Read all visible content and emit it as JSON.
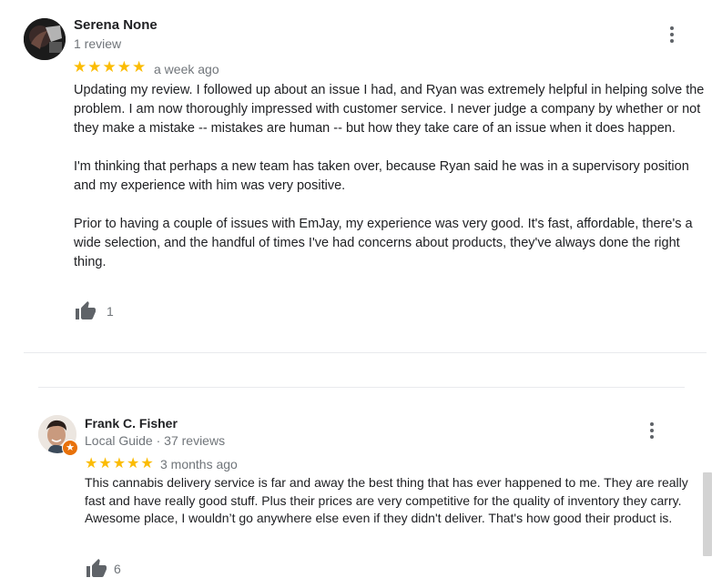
{
  "reviews": [
    {
      "author": "Serena None",
      "meta": "1 review",
      "stars": "★★★★★",
      "rating": 5,
      "time": "a week ago",
      "paragraphs": [
        "Updating my review. I followed up about an issue I had, and Ryan was extremely helpful in helping solve the problem. I am now thoroughly impressed with customer service. I never judge a company by whether or not they make a mistake -- mistakes are human -- but how they take care of an issue when it does happen.",
        "I'm thinking that perhaps a new team has taken over, because Ryan said he was in a supervisory position and my experience with him was very positive.",
        "Prior to having a couple of issues with EmJay, my experience was very good. It's fast, affordable, there's a wide selection, and the handful of times I've had concerns about products, they've always done the right thing."
      ],
      "likes": "1"
    },
    {
      "author": "Frank C. Fisher",
      "meta": "Local Guide · 37 reviews",
      "stars": "★★★★★",
      "rating": 5,
      "time": "3 months ago",
      "paragraphs": [
        "This cannabis delivery service is far and away the best thing that has ever happened to me. They are really fast and have really good stuff. Plus their prices are very competitive for the quality of inventory they carry. Awesome place, I wouldn’t go anywhere else even if they didn't deliver. That's how good their product is."
      ],
      "likes": "6"
    }
  ],
  "colors": {
    "star": "#fbbc04",
    "badge": "#e8710a",
    "icon": "#5f6368"
  },
  "icons": {
    "menu": "more-vert-icon",
    "like": "thumb-up-icon",
    "local_guide": "local-guide-badge-icon"
  }
}
